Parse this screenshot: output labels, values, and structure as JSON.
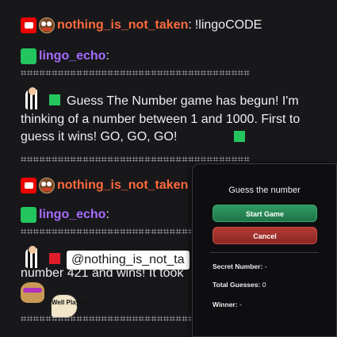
{
  "messages": [
    {
      "user": "nothing_is_not_taken",
      "text": "!lingoCODE"
    },
    {
      "user": "lingo_echo",
      "divider": "⌗⌗⌗⌗⌗⌗⌗⌗⌗⌗⌗⌗⌗⌗⌗⌗⌗⌗⌗⌗⌗⌗⌗⌗⌗⌗⌗⌗⌗⌗⌗⌗⌗⌗⌗⌗⌗",
      "text": "Guess The Number game has begun! I'm thinking of a number between 1 and 1000. First to guess it wins! GO, GO, GO!"
    },
    {
      "user": "nothing_is_not_taken"
    },
    {
      "user": "lingo_echo",
      "mention": "@nothing_is_not_ta",
      "text": "number 421 and wins! It took",
      "emote_text": "Well Played"
    }
  ],
  "colon": ":",
  "panel": {
    "title": "Guess the number",
    "start_label": "Start Game",
    "cancel_label": "Cancel",
    "secret_label": "Secret Number:",
    "secret_value": "-",
    "guesses_label": "Total Guesses:",
    "guesses_value": "0",
    "winner_label": "Winner:",
    "winner_value": "-"
  },
  "colors": {
    "background": "#18181b",
    "panel": "#0e0e10",
    "user_orange": "#ff6a3d",
    "user_purple": "#a66cff",
    "start": "#2f9a62",
    "cancel": "#b33a34"
  }
}
